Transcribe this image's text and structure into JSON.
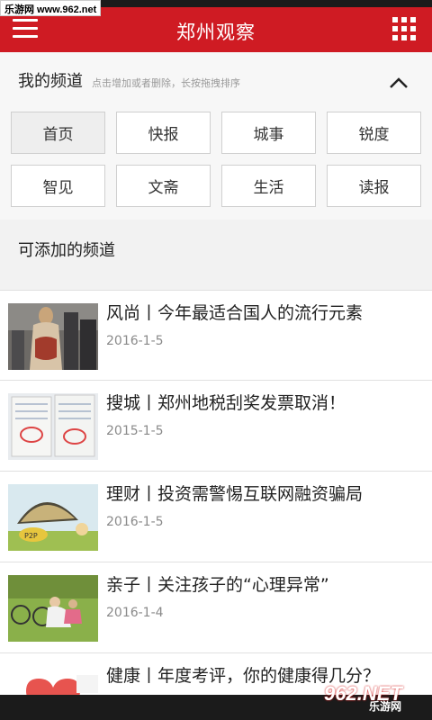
{
  "watermark_top": "乐游网 www.962.net",
  "appbar": {
    "title": "郑州观察"
  },
  "channels": {
    "title": "我的频道",
    "hint": "点击增加或者删除，长按拖拽排序",
    "items": [
      "首页",
      "快报",
      "城事",
      "锐度",
      "智见",
      "文斋",
      "生活",
      "读报"
    ]
  },
  "addable": {
    "label": "可添加的频道"
  },
  "news": [
    {
      "headline": "风尚丨今年最适合国人的流行元素",
      "date": "2016-1-5"
    },
    {
      "headline": "搜城丨郑州地税刮奖发票取消！",
      "date": "2015-1-5"
    },
    {
      "headline": "理财丨投资需警惕互联网融资骗局",
      "date": "2016-1-5"
    },
    {
      "headline": "亲子丨关注孩子的“心理异常”",
      "date": "2016-1-4"
    },
    {
      "headline": "健康丨年度考评，你的健康得几分？",
      "date": ""
    }
  ],
  "watermark_bottom": {
    "logo": "962.NET",
    "sub": "乐游网"
  },
  "colors": {
    "appbar": "#cf1b23",
    "panel": "#f7f7f7",
    "date": "#8a8a8a"
  }
}
